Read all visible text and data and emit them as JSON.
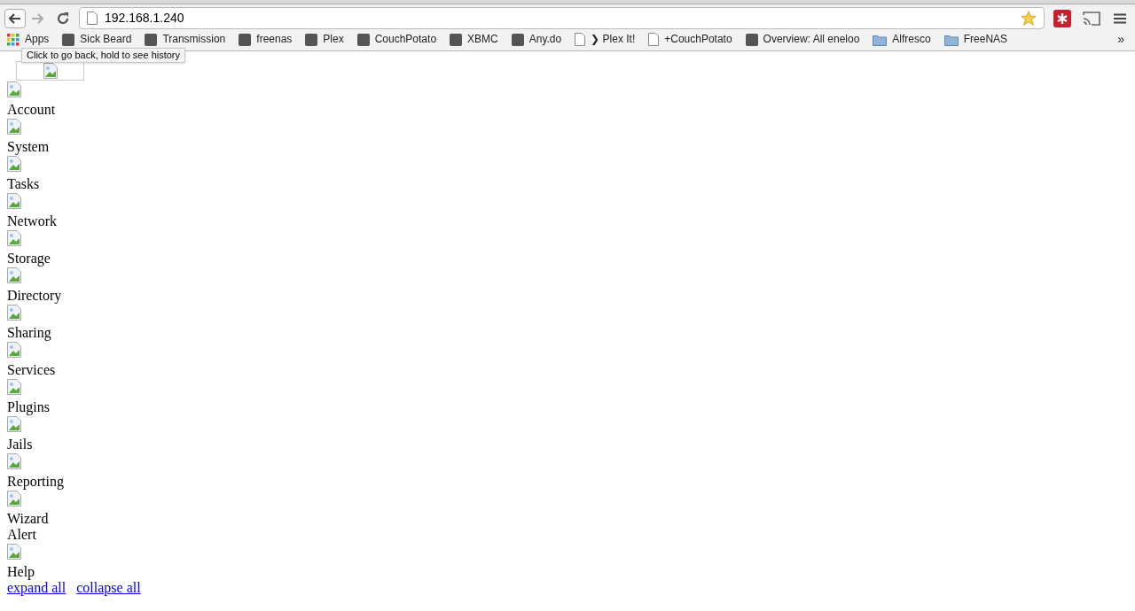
{
  "browser": {
    "address": "192.168.1.240",
    "tooltip": "Click to go back, hold to see history",
    "bookmarks": [
      {
        "label": "Apps",
        "kind": "apps"
      },
      {
        "label": "Sick Beard",
        "kind": "site"
      },
      {
        "label": "Transmission",
        "kind": "site"
      },
      {
        "label": "freenas",
        "kind": "site"
      },
      {
        "label": "Plex",
        "kind": "site"
      },
      {
        "label": "CouchPotato",
        "kind": "site"
      },
      {
        "label": "XBMC",
        "kind": "site"
      },
      {
        "label": "Any.do",
        "kind": "site"
      },
      {
        "label": "❯ Plex It!",
        "kind": "page"
      },
      {
        "label": "+CouchPotato",
        "kind": "page"
      },
      {
        "label": "Overview: All eneloo",
        "kind": "site"
      },
      {
        "label": "Alfresco",
        "kind": "folder"
      },
      {
        "label": "FreeNAS",
        "kind": "folder"
      }
    ],
    "overflow": "»"
  },
  "menu": [
    {
      "label": "Account",
      "kind": "icon"
    },
    {
      "label": "System",
      "kind": "icon"
    },
    {
      "label": "Tasks",
      "kind": "icon"
    },
    {
      "label": "Network",
      "kind": "icon"
    },
    {
      "label": "Storage",
      "kind": "icon"
    },
    {
      "label": "Directory",
      "kind": "icon"
    },
    {
      "label": "Sharing",
      "kind": "icon"
    },
    {
      "label": "Services",
      "kind": "icon"
    },
    {
      "label": "Plugins",
      "kind": "icon"
    },
    {
      "label": "Jails",
      "kind": "icon"
    },
    {
      "label": "Reporting",
      "kind": "icon"
    },
    {
      "label": "Wizard",
      "kind": "icon"
    },
    {
      "label": "Alert",
      "kind": "text"
    },
    {
      "label": "Help",
      "kind": "icon"
    }
  ],
  "links": [
    "expand all",
    "collapse all"
  ]
}
